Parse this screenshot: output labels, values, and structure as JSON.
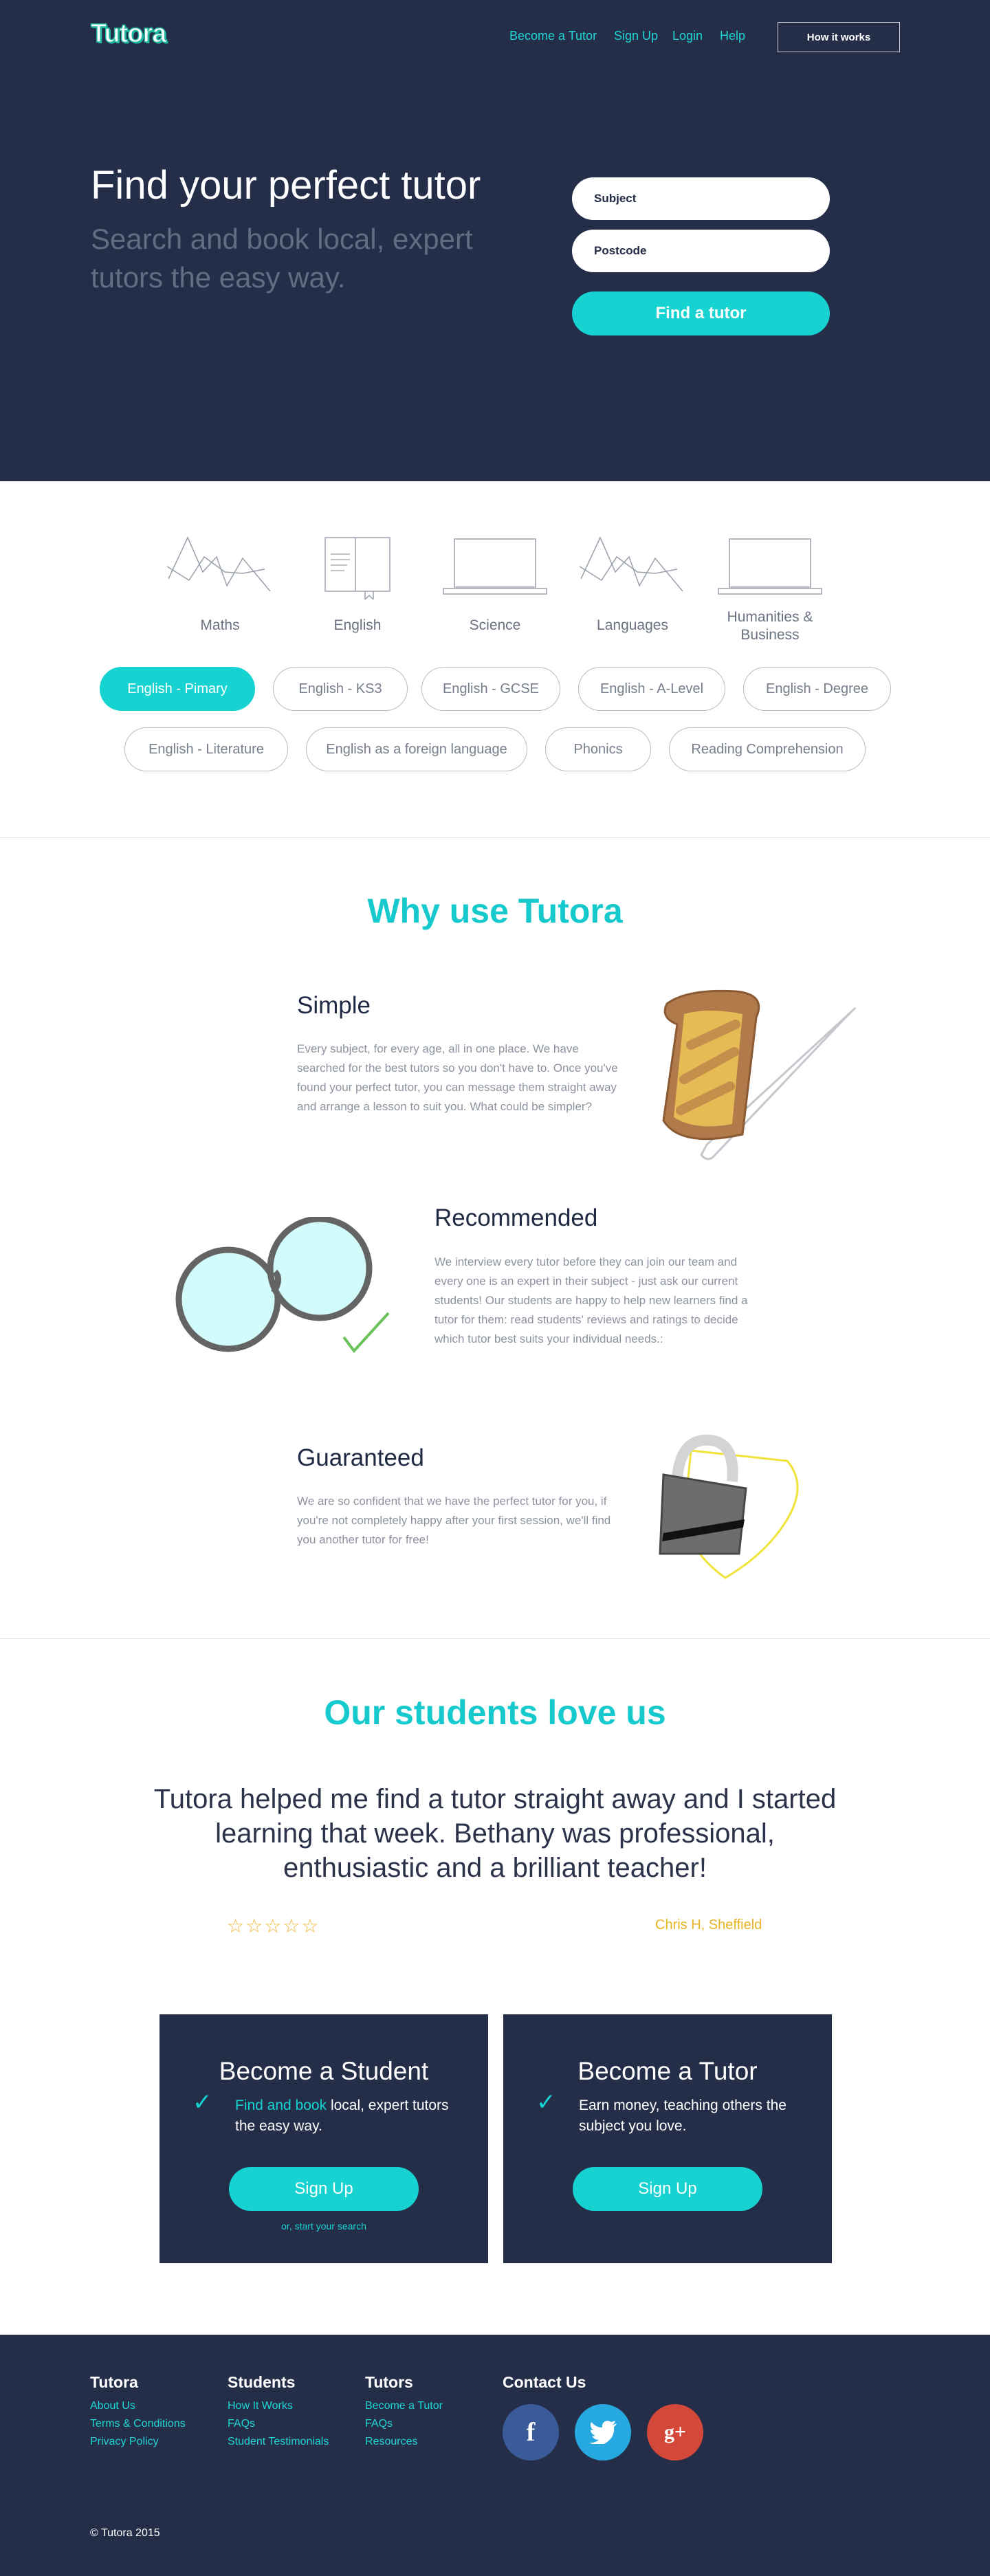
{
  "header": {
    "logo": "Tutora",
    "nav": [
      "Become a Tutor",
      "Sign Up",
      "Login",
      "Help"
    ],
    "cta": "How it works"
  },
  "hero": {
    "title": "Find your perfect tutor",
    "subtitle": "Search and book local, expert tutors the easy way.",
    "subject_placeholder": "Subject",
    "postcode_placeholder": "Postcode",
    "search_button": "Find a tutor"
  },
  "subjects": {
    "categories": [
      "Maths",
      "English",
      "Science",
      "Languages",
      "Humanities & Business"
    ],
    "levels": [
      "English - Pimary",
      "English - KS3",
      "English - GCSE",
      "English - A-Level",
      "English - Degree",
      "English - Literature",
      "English as a foreign language",
      "Phonics",
      "Reading Comprehension"
    ],
    "active_level": "English - Pimary"
  },
  "why": {
    "title": "Why use Tutora",
    "items": [
      {
        "heading": "Simple",
        "text": "Every subject, for every age, all in one place. We have searched for the best tutors so you don't have to. Once you've found your perfect tutor, you can message them straight away and arrange a lesson to suit you. What could be simpler?"
      },
      {
        "heading": "Recommended",
        "text": "We interview every tutor before they can join our team and every one is an expert in their subject - just ask our current students! Our students are happy to help new learners find a tutor for them: read students' reviews and ratings to decide which tutor best suits your individual needs.:"
      },
      {
        "heading": "Guaranteed",
        "text": "We are so confident that we have the perfect tutor for you, if you're not completely happy after your first session, we'll find you another tutor for free!"
      }
    ]
  },
  "testimonials": {
    "title": "Our students love us",
    "quote": "Tutora helped me find a tutor straight away and I started learning that week. Bethany was professional, enthusiastic and a brilliant teacher!",
    "stars": "☆☆☆☆☆",
    "rating": 5,
    "author": "Chris H, Sheffield"
  },
  "cta": {
    "student": {
      "title": "Become a Student",
      "highlight": "Find and book",
      "text": " local, expert tutors the easy way.",
      "button": "Sign Up",
      "link": "or, start your search"
    },
    "tutor": {
      "title": "Become a Tutor",
      "text": "Earn money, teaching others the subject you love.",
      "button": "Sign Up"
    }
  },
  "footer": {
    "cols": [
      {
        "title": "Tutora",
        "links": [
          "About Us",
          "Terms & Conditions",
          "Privacy Policy"
        ]
      },
      {
        "title": "Students",
        "links": [
          "How It Works",
          "FAQs",
          "Student Testimonials"
        ]
      },
      {
        "title": "Tutors",
        "links": [
          "Become a Tutor",
          "FAQs",
          "Resources"
        ]
      }
    ],
    "contact_title": "Contact Us",
    "social": [
      {
        "icon": "facebook-icon",
        "glyph": "f",
        "color": "#3b5a99"
      },
      {
        "icon": "twitter-icon",
        "glyph": "🐦",
        "color": "#26a9e0"
      },
      {
        "icon": "google-plus-icon",
        "glyph": "g+",
        "color": "#d4483a"
      }
    ],
    "copyright": "© Tutora 2015"
  },
  "colors": {
    "navy": "#252e49",
    "accent": "#16d3d2",
    "gold": "#e9b322"
  }
}
